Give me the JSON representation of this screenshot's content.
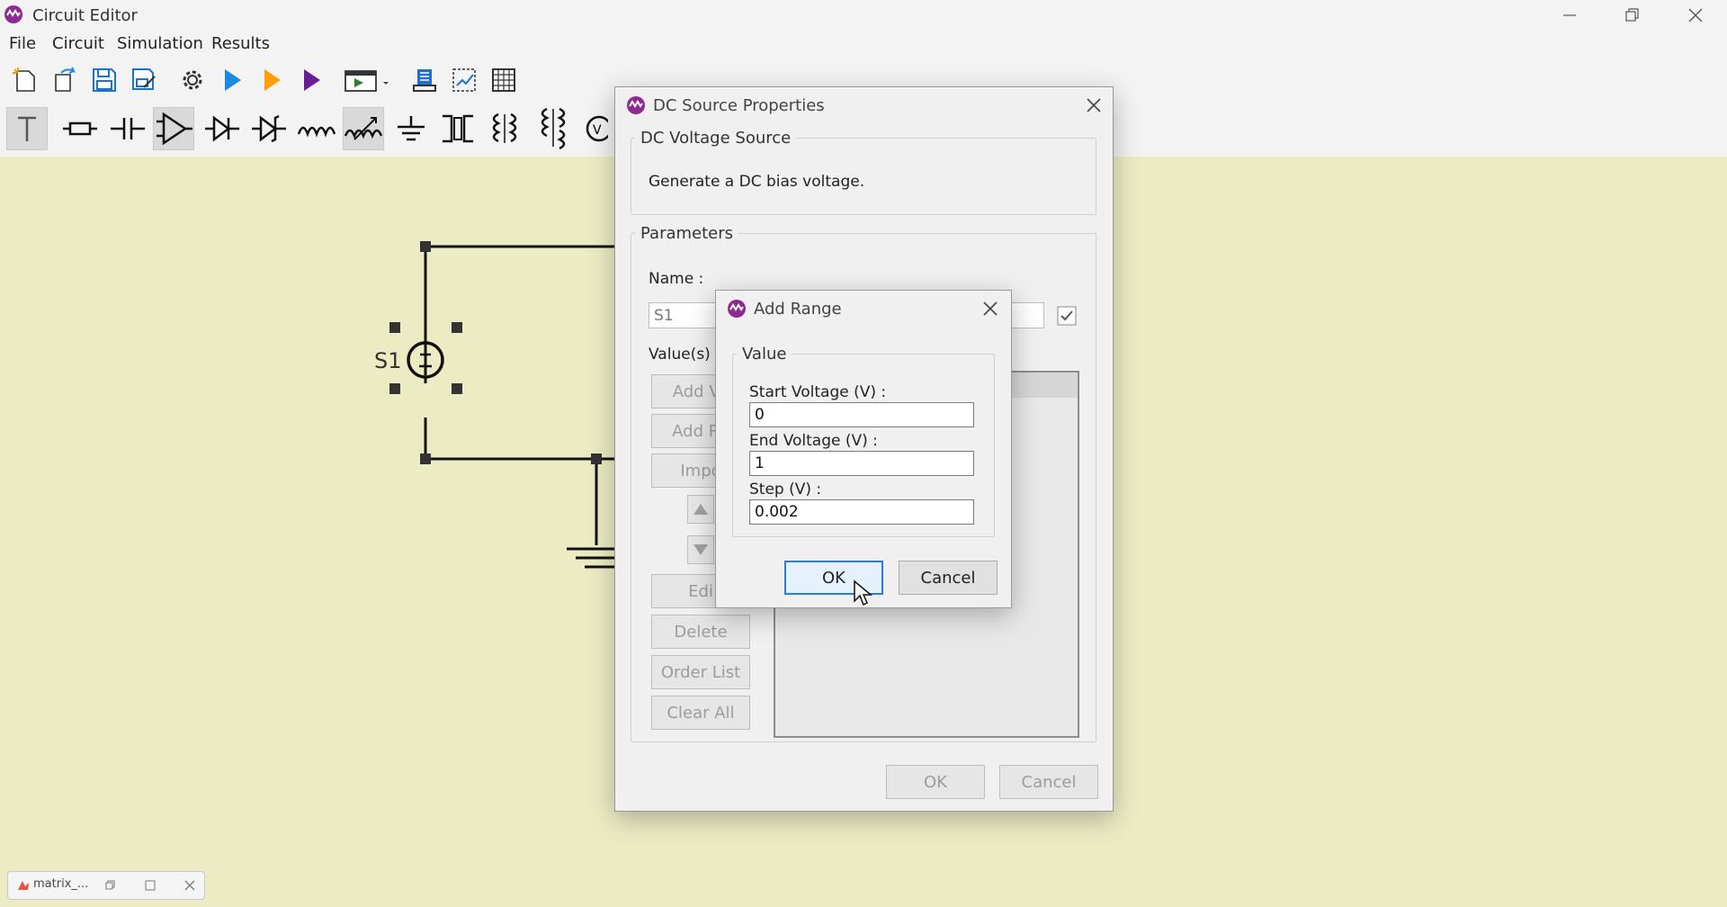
{
  "window": {
    "title": "Circuit Editor"
  },
  "menu": [
    "File",
    "Circuit",
    "Simulation",
    "Results"
  ],
  "toolbar1_icons": [
    "new-file-icon",
    "open-file-icon",
    "save-icon",
    "save-as-icon",
    "settings-gear-icon",
    "run-blue-icon",
    "run-orange-icon",
    "run-purple-icon",
    "simulation-window-icon",
    "probe-icon",
    "fit-view-icon",
    "grid-icon"
  ],
  "toolbar2_icons": [
    "text-tool-icon",
    "resistor-icon",
    "capacitor-icon",
    "opamp-icon",
    "diode-icon",
    "zener-diode-icon",
    "inductor-icon",
    "variable-resistor-icon",
    "ground-icon",
    "transformer-icon",
    "coupled-inductor-icon",
    "coupled-inductor-3-icon",
    "voltage-source-icon"
  ],
  "schematic": {
    "source_label": "S1"
  },
  "dc_dialog": {
    "title": "DC Source Properties",
    "group_title": "DC Voltage Source",
    "description": "Generate a DC bias voltage.",
    "params_title": "Parameters",
    "name_label": "Name :",
    "name_value": "S1",
    "values_label": "Value(s) :",
    "buttons": {
      "add_value": "Add Va",
      "add_range": "Add Ra",
      "import": "Impo",
      "edit": "Edi",
      "delete": "Delete",
      "order_list": "Order List",
      "clear_all": "Clear All"
    },
    "ok": "OK",
    "cancel": "Cancel"
  },
  "range_dialog": {
    "title": "Add Range",
    "group_title": "Value",
    "start_label": "Start Voltage (V) :",
    "start_value": "0",
    "end_label": "End Voltage (V) :",
    "end_value": "1",
    "step_label": "Step (V) :",
    "step_value": "0.002",
    "ok": "OK",
    "cancel": "Cancel"
  },
  "minimized": {
    "label": "matrix_..."
  },
  "colors": {
    "canvas": "#ECECC4",
    "accent_blue": "#1E88E5",
    "accent_orange": "#FFA000",
    "accent_purple": "#7B1FA2",
    "logo": "#8E2A8F"
  }
}
